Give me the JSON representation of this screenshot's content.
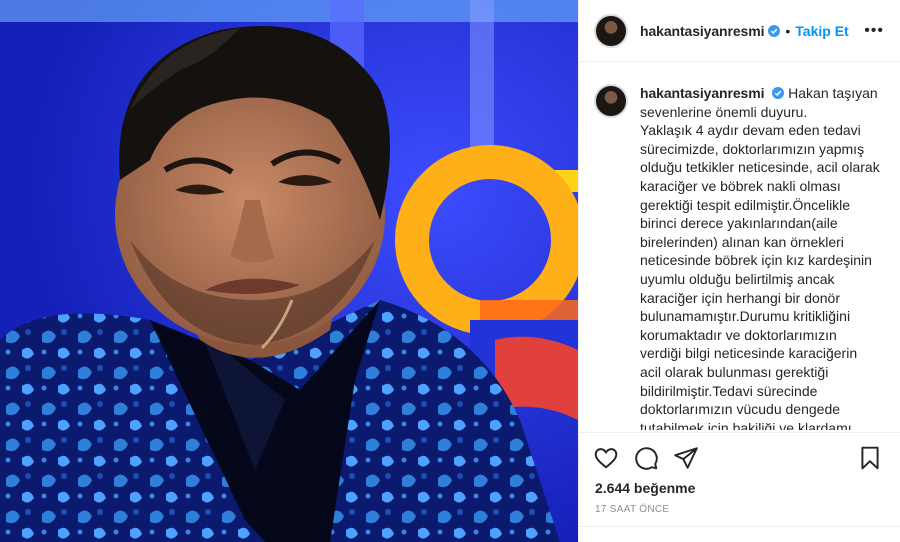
{
  "post": {
    "username": "hakantasiyanresmi",
    "follow_label": "Takip Et",
    "separator": "•",
    "more_label": "•••",
    "caption": "Hakan taşıyan sevenlerine önemli duyuru.\nYaklaşık 4 aydır devam eden tedavi sürecimizde, doktorlarımızın yapmış olduğu tetkikler neticesinde, acil olarak karaciğer ve böbrek nakli olması gerektiği tespit edilmiştir.Öncelikle birinci derece yakınlarından(aile birelerinden) alınan kan örnekleri neticesinde böbrek için kız kardeşinin uyumlu olduğu belirtilmiş ancak karaciğer için herhangi bir donör bulunamamıştır.Durumu kritikliğini korumaktadır ve doktorlarımızın verdiği bilgi neticesinde karaciğerin acil olarak bulunması gerektiği bildirilmiştir.Tedavi sürecinde doktorlarımızın vücudu dengede tutabilmek için bakiliği ve klardamı",
    "likes": "2.644 beğenme",
    "time_ago": "17 SAAT ÖNCE"
  },
  "icons": {
    "verified": "verified-badge-icon",
    "like": "heart-icon",
    "comment": "comment-icon",
    "share": "paper-plane-icon",
    "save": "bookmark-icon"
  },
  "colors": {
    "accent": "#0095f6",
    "verified": "#3897f0",
    "studio_blue": "#1d2bd8",
    "studio_orange": "#ffb018"
  }
}
